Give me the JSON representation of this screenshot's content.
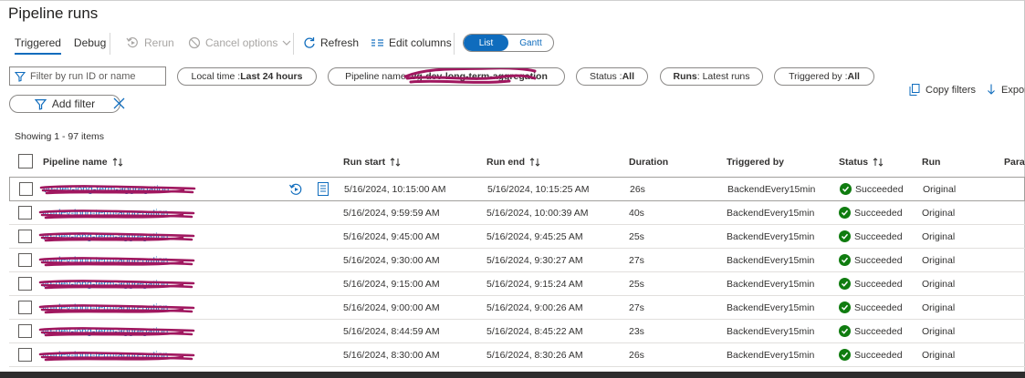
{
  "page": {
    "title": "Pipeline runs"
  },
  "tabs": [
    {
      "label": "Triggered",
      "active": true
    },
    {
      "label": "Debug",
      "active": false
    }
  ],
  "toolbar": {
    "rerun": "Rerun",
    "cancel_options": "Cancel options",
    "refresh": "Refresh",
    "edit_columns": "Edit columns",
    "view_toggle": {
      "list": "List",
      "gantt": "Gantt",
      "selected": "List"
    }
  },
  "filters": {
    "search_placeholder": "Filter by run ID or name",
    "local_time": {
      "label": "Local time : ",
      "value": "Last 24 hours"
    },
    "pipeline_name": {
      "label": "Pipeline name : ",
      "value": "vg-dev-long-term-aggregation"
    },
    "status": {
      "label": "Status : ",
      "value": "All"
    },
    "runs": {
      "label": "Runs",
      "value": " : Latest runs"
    },
    "triggered_by": {
      "label": "Triggered by : ",
      "value": "All"
    },
    "add_filter": "Add filter",
    "copy_filters": "Copy filters",
    "export": "Expor"
  },
  "summary": {
    "showing": "Showing 1 - 97 items"
  },
  "columns": {
    "pipeline_name": "Pipeline name",
    "run_start": "Run start",
    "run_end": "Run end",
    "duration": "Duration",
    "triggered_by": "Triggered by",
    "status": "Status",
    "run": "Run",
    "parameters": "Para"
  },
  "rows": [
    {
      "name": "vg-dev-long-term-aggregation",
      "start": "5/16/2024, 10:15:00 AM",
      "end": "5/16/2024, 10:15:25 AM",
      "duration": "26s",
      "triggered_by": "BackendEvery15min",
      "status": "Succeeded",
      "run": "Original"
    },
    {
      "name": "vg-dev-long-term-aggregation",
      "start": "5/16/2024, 9:59:59 AM",
      "end": "5/16/2024, 10:00:39 AM",
      "duration": "40s",
      "triggered_by": "BackendEvery15min",
      "status": "Succeeded",
      "run": "Original"
    },
    {
      "name": "vg-dev-long-term-aggregation",
      "start": "5/16/2024, 9:45:00 AM",
      "end": "5/16/2024, 9:45:25 AM",
      "duration": "25s",
      "triggered_by": "BackendEvery15min",
      "status": "Succeeded",
      "run": "Original"
    },
    {
      "name": "vg-dev-long-term-aggregation",
      "start": "5/16/2024, 9:30:00 AM",
      "end": "5/16/2024, 9:30:27 AM",
      "duration": "27s",
      "triggered_by": "BackendEvery15min",
      "status": "Succeeded",
      "run": "Original"
    },
    {
      "name": "vg-dev-long-term-aggregation",
      "start": "5/16/2024, 9:15:00 AM",
      "end": "5/16/2024, 9:15:24 AM",
      "duration": "25s",
      "triggered_by": "BackendEvery15min",
      "status": "Succeeded",
      "run": "Original"
    },
    {
      "name": "vg-dev-long-term-aggregation",
      "start": "5/16/2024, 9:00:00 AM",
      "end": "5/16/2024, 9:00:26 AM",
      "duration": "27s",
      "triggered_by": "BackendEvery15min",
      "status": "Succeeded",
      "run": "Original"
    },
    {
      "name": "vg-dev-long-term-aggregation",
      "start": "5/16/2024, 8:44:59 AM",
      "end": "5/16/2024, 8:45:22 AM",
      "duration": "23s",
      "triggered_by": "BackendEvery15min",
      "status": "Succeeded",
      "run": "Original"
    },
    {
      "name": "vg-dev-long-term-aggregation",
      "start": "5/16/2024, 8:30:00 AM",
      "end": "5/16/2024, 8:30:26 AM",
      "duration": "26s",
      "triggered_by": "BackendEvery15min",
      "status": "Succeeded",
      "run": "Original"
    }
  ],
  "icons": {
    "rerun": "rerun-icon",
    "cancel": "cancel-circle-icon",
    "refresh": "refresh-icon",
    "edit_columns": "edit-columns-icon",
    "filter": "filter-funnel-icon",
    "copy": "copy-icon",
    "export": "download-icon",
    "clear": "close-icon",
    "status_ok": "check-circle-icon",
    "row_rerun": "rerun-icon",
    "row_consumption": "document-icon",
    "sort": "sort-arrows-icon"
  },
  "colors": {
    "accent": "#0f6cbd",
    "success": "#107c10",
    "redaction": "#a0175f"
  }
}
